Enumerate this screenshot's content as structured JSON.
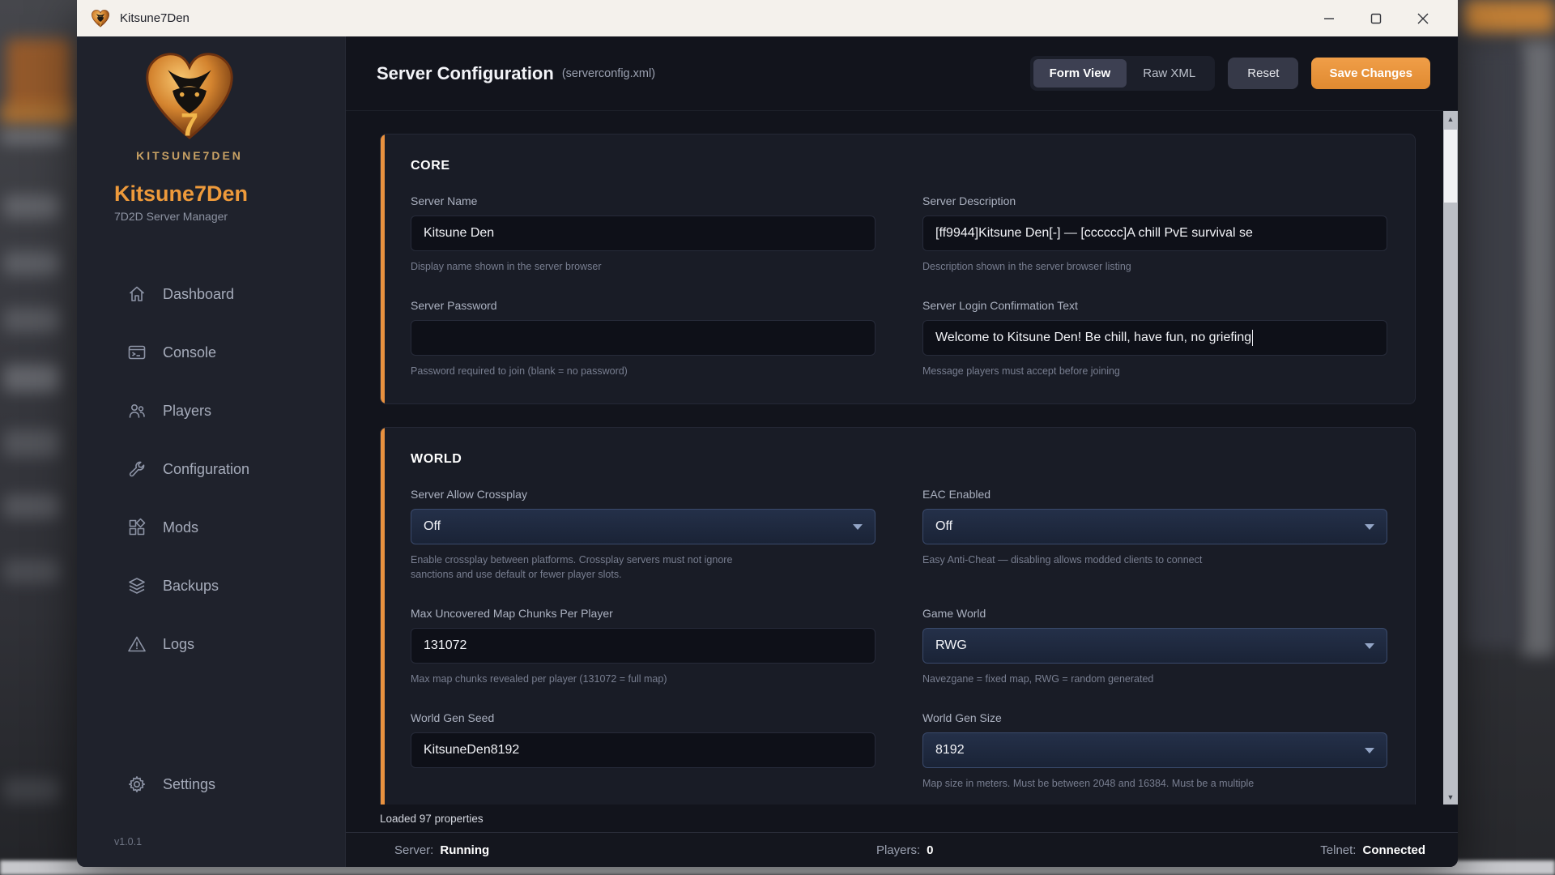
{
  "titlebar": {
    "title": "Kitsune7Den"
  },
  "sidebar": {
    "logo_caption": "KITSUNE7DEN",
    "app_name": "Kitsune7Den",
    "app_subtitle": "7D2D Server Manager",
    "nav": [
      {
        "label": "Dashboard",
        "icon": "home-icon"
      },
      {
        "label": "Console",
        "icon": "console-icon"
      },
      {
        "label": "Players",
        "icon": "players-icon"
      },
      {
        "label": "Configuration",
        "icon": "wrench-icon"
      },
      {
        "label": "Mods",
        "icon": "mods-grid-icon"
      },
      {
        "label": "Backups",
        "icon": "layers-icon"
      },
      {
        "label": "Logs",
        "icon": "warning-triangle-icon"
      }
    ],
    "settings": {
      "label": "Settings",
      "icon": "gear-icon"
    },
    "version": "v1.0.1"
  },
  "header": {
    "title": "Server Configuration",
    "subtitle": "(serverconfig.xml)",
    "toggle": {
      "form_view": "Form View",
      "raw_xml": "Raw XML",
      "active": "Form View"
    },
    "reset_label": "Reset",
    "save_label": "Save Changes"
  },
  "core": {
    "title": "CORE",
    "fields": [
      {
        "label": "Server Name",
        "type": "text",
        "value": "Kitsune Den",
        "helper": "Display name shown in the server browser"
      },
      {
        "label": "Server Description",
        "type": "text",
        "value": "[ff9944]Kitsune Den[-] — [cccccc]A chill PvE survival se",
        "helper": "Description shown in the server browser listing"
      },
      {
        "label": "Server Password",
        "type": "text",
        "value": "",
        "helper": "Password required to join (blank = no password)"
      },
      {
        "label": "Server Login Confirmation Text",
        "type": "text",
        "value": "Welcome to Kitsune Den! Be chill, have fun, no griefing",
        "helper": "Message players must accept before joining"
      }
    ]
  },
  "world": {
    "title": "WORLD",
    "fields": [
      {
        "label": "Server Allow Crossplay",
        "type": "select",
        "value": "Off",
        "helper": "Enable crossplay between platforms. Crossplay servers must not ignore sanctions and use default or fewer player slots."
      },
      {
        "label": "EAC Enabled",
        "type": "select",
        "value": "Off",
        "helper": "Easy Anti-Cheat — disabling allows modded clients to connect"
      },
      {
        "label": "Max Uncovered Map Chunks Per Player",
        "type": "text",
        "value": "131072",
        "helper": "Max map chunks revealed per player (131072 = full map)"
      },
      {
        "label": "Game World",
        "type": "select",
        "value": "RWG",
        "helper": "Navezgane = fixed map, RWG = random generated"
      },
      {
        "label": "World Gen Seed",
        "type": "text",
        "value": "KitsuneDen8192",
        "helper": ""
      },
      {
        "label": "World Gen Size",
        "type": "select",
        "value": "8192",
        "helper": "Map size in meters. Must be between 2048 and 16384. Must be a multiple"
      }
    ]
  },
  "footer": {
    "loaded_text": "Loaded 97 properties"
  },
  "statusbar": {
    "server_label": "Server:",
    "server_value": "Running",
    "players_label": "Players:",
    "players_value": "0",
    "telnet_label": "Telnet:",
    "telnet_value": "Connected"
  },
  "colors": {
    "accent_orange": "#e8913f",
    "save_button": "#e8933d",
    "titlebar_bg": "#f4f1ec",
    "sidebar_bg": "#1f222c",
    "content_bg": "#12141c",
    "card_bg": "#191c26",
    "select_bg": "#1f2a42"
  }
}
